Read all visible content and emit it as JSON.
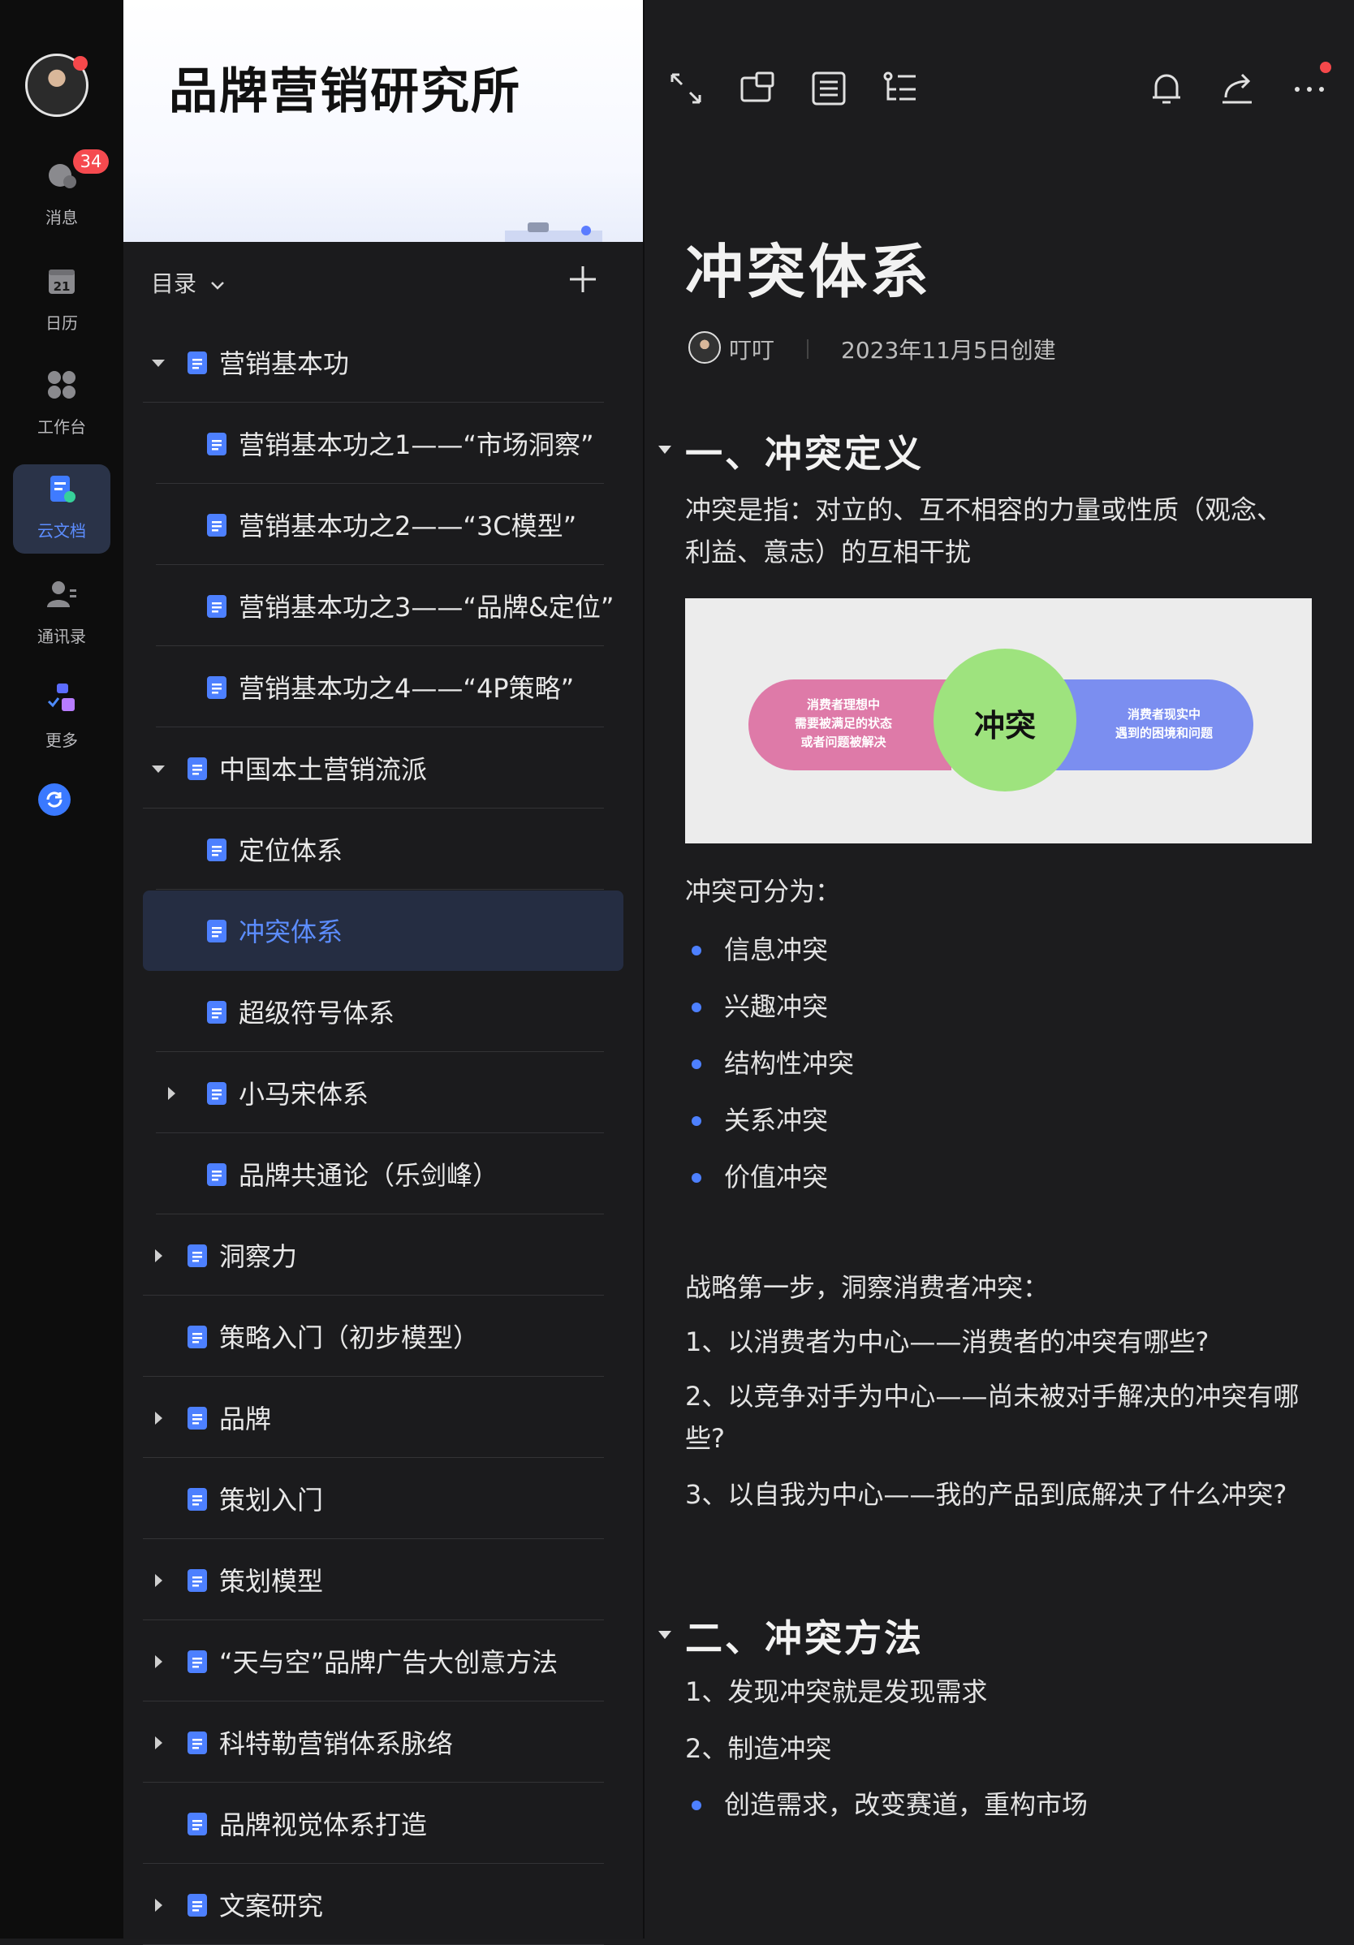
{
  "rail": {
    "messages_badge": "34",
    "messages_label": "消息",
    "calendar_day": "21",
    "calendar_label": "日历",
    "workspace_label": "工作台",
    "docs_label": "云文档",
    "contacts_label": "通讯录",
    "more_label": "更多"
  },
  "sidebar": {
    "space_title": "品牌营销研究所",
    "toc_label": "目录",
    "items": [
      {
        "label": "营销基本功",
        "depth": 0,
        "expand": "expanded"
      },
      {
        "label": "营销基本功之1——“市场洞察”",
        "depth": 1,
        "expand": "none"
      },
      {
        "label": "营销基本功之2——“3C模型”",
        "depth": 1,
        "expand": "none"
      },
      {
        "label": "营销基本功之3——“品牌&定位”",
        "depth": 1,
        "expand": "none"
      },
      {
        "label": "营销基本功之4——“4P策略”",
        "depth": 1,
        "expand": "none"
      },
      {
        "label": "中国本土营销流派",
        "depth": 0,
        "expand": "expanded"
      },
      {
        "label": "定位体系",
        "depth": 1,
        "expand": "none"
      },
      {
        "label": "冲突体系",
        "depth": 1,
        "expand": "none",
        "selected": true
      },
      {
        "label": "超级符号体系",
        "depth": 1,
        "expand": "none"
      },
      {
        "label": "小马宋体系",
        "depth": 1,
        "expand": "collapsed"
      },
      {
        "label": "品牌共通论（乐剑峰）",
        "depth": 1,
        "expand": "none"
      },
      {
        "label": "洞察力",
        "depth": 0,
        "expand": "collapsed"
      },
      {
        "label": "策略入门（初步模型）",
        "depth": 0,
        "expand": "none"
      },
      {
        "label": "品牌",
        "depth": 0,
        "expand": "collapsed"
      },
      {
        "label": "策划入门",
        "depth": 0,
        "expand": "none"
      },
      {
        "label": "策划模型",
        "depth": 0,
        "expand": "collapsed"
      },
      {
        "label": "“天与空”品牌广告大创意方法",
        "depth": 0,
        "expand": "collapsed"
      },
      {
        "label": "科特勒营销体系脉络",
        "depth": 0,
        "expand": "collapsed"
      },
      {
        "label": "品牌视觉体系打造",
        "depth": 0,
        "expand": "none"
      },
      {
        "label": "文案研究",
        "depth": 0,
        "expand": "collapsed"
      }
    ]
  },
  "doc": {
    "title": "冲突体系",
    "author": "叮叮",
    "created": "2023年11月5日创建",
    "section1": "一、冲突定义",
    "def_line1": "冲突是指：对立的、互不相容的力量或性质（观念、",
    "def_line2": "利益、意志）的互相干扰",
    "diagram": {
      "left_lines": [
        "消费者理想中",
        "需要被满足的状态",
        "或者问题被解决"
      ],
      "center": "冲突",
      "right_lines": [
        "消费者现实中",
        "遇到的困境和问题"
      ]
    },
    "types_intro": "冲突可分为：",
    "types": [
      "信息冲突",
      "兴趣冲突",
      "结构性冲突",
      "关系冲突",
      "价值冲突"
    ],
    "strategy_intro": "战略第一步，洞察消费者冲突：",
    "strategy_1": "1、以消费者为中心——消费者的冲突有哪些?",
    "strategy_2a": "2、以竞争对手为中心——尚未被对手解决的冲突有哪",
    "strategy_2b": "些?",
    "strategy_3": "3、以自我为中心——我的产品到底解决了什么冲突?",
    "section2": "二、冲突方法",
    "method_1": "1、发现冲突就是发现需求",
    "method_2": "2、制造冲突",
    "method_bullet": "创造需求，改变赛道，重构市场"
  },
  "icons": [
    "expand-icon",
    "floating-window-icon",
    "outline-icon",
    "list-tree-icon",
    "bell-icon",
    "share-icon",
    "more-icon"
  ],
  "colors": {
    "accent": "#5c8dff",
    "badge": "#f54a4f",
    "conflict_green": "#9ee37e",
    "ideal_pink": "#de7aa8",
    "reality_blue": "#7b8ef0"
  }
}
